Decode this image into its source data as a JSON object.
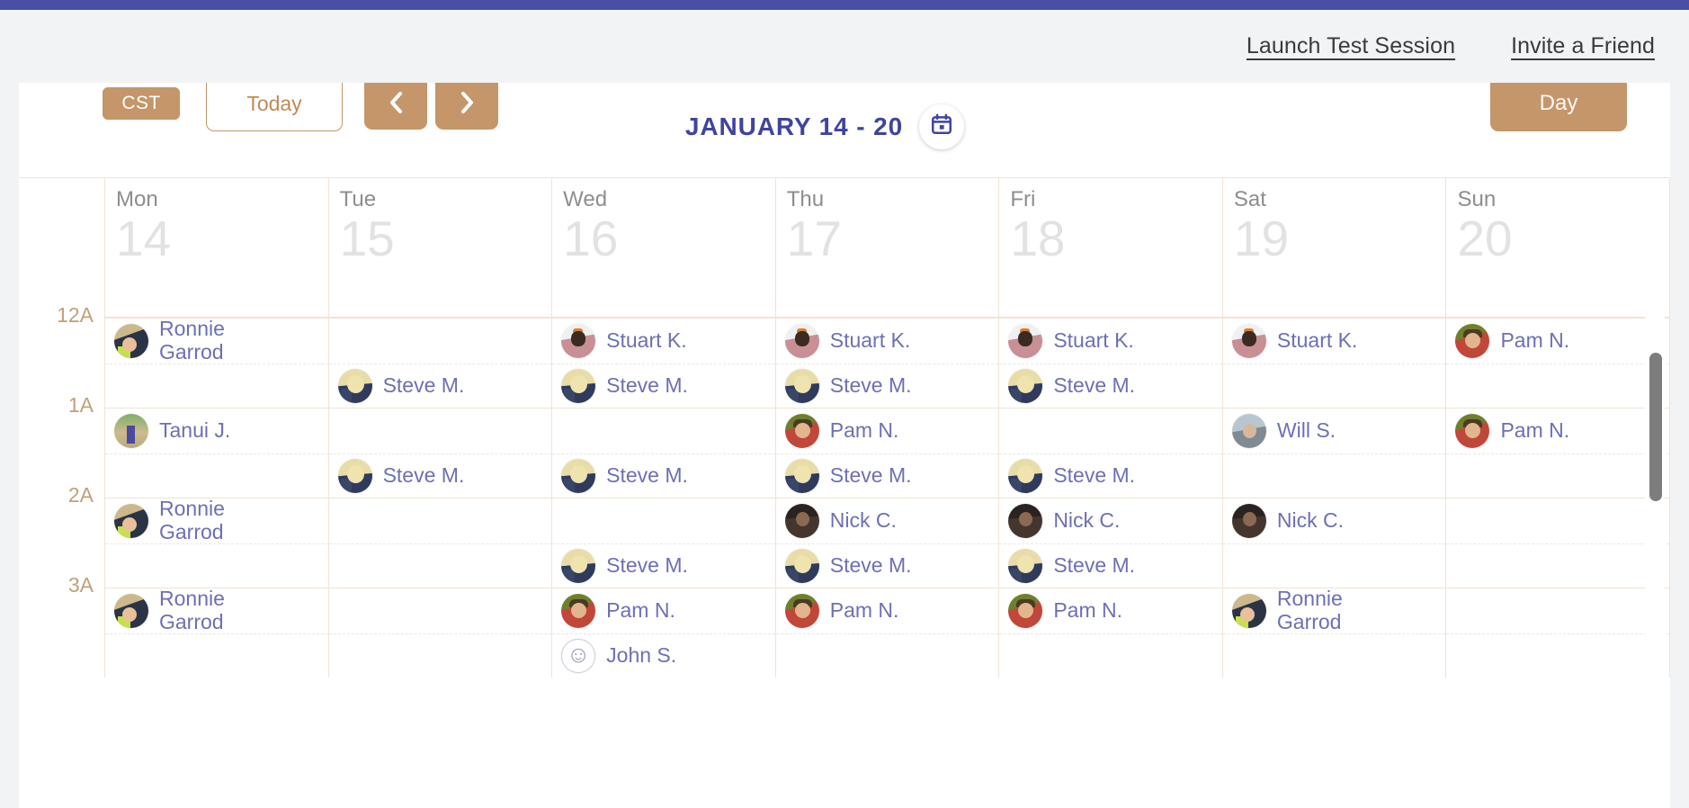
{
  "theme": {
    "purple_bar": "#4a4fa6",
    "accent_tan": "#c4966a",
    "title_blue": "#3f44a0",
    "event_text": "#6d6fb5",
    "grid_line": "#efe3d6",
    "hour_label": "#c0a079"
  },
  "header": {
    "links": [
      {
        "label": "Launch Test Session",
        "name": "launch-test-session-link"
      },
      {
        "label": "Invite a Friend",
        "name": "invite-a-friend-link"
      }
    ]
  },
  "toolbar": {
    "timezone_badge": "CST",
    "today_label": "Today",
    "prev_icon": "chevron-left-icon",
    "next_icon": "chevron-right-icon",
    "title": "JANUARY 14 - 20",
    "calendar_icon": "calendar-icon",
    "view_label": "Day"
  },
  "calendar": {
    "days": [
      {
        "name": "Mon",
        "num": "14"
      },
      {
        "name": "Tue",
        "num": "15"
      },
      {
        "name": "Wed",
        "num": "16"
      },
      {
        "name": "Thu",
        "num": "17"
      },
      {
        "name": "Fri",
        "num": "18"
      },
      {
        "name": "Sat",
        "num": "19"
      },
      {
        "name": "Sun",
        "num": "20"
      }
    ],
    "hours": [
      {
        "label": "12A",
        "cells": [
          {
            "top": {
              "name": "Ronnie Garrod",
              "avatar": "av-ronnie",
              "two_line": true
            },
            "bottom": null
          },
          {
            "top": null,
            "bottom": {
              "name": "Steve M.",
              "avatar": "av-steve"
            }
          },
          {
            "top": {
              "name": "Stuart K.",
              "avatar": "av-stuart"
            },
            "bottom": {
              "name": "Steve M.",
              "avatar": "av-steve"
            }
          },
          {
            "top": {
              "name": "Stuart K.",
              "avatar": "av-stuart"
            },
            "bottom": {
              "name": "Steve M.",
              "avatar": "av-steve"
            }
          },
          {
            "top": {
              "name": "Stuart K.",
              "avatar": "av-stuart"
            },
            "bottom": {
              "name": "Steve M.",
              "avatar": "av-steve"
            }
          },
          {
            "top": {
              "name": "Stuart K.",
              "avatar": "av-stuart"
            },
            "bottom": null
          },
          {
            "top": {
              "name": "Pam N.",
              "avatar": "av-pam"
            },
            "bottom": null
          }
        ]
      },
      {
        "label": "1A",
        "cells": [
          {
            "top": {
              "name": "Tanui J.",
              "avatar": "av-tanui"
            },
            "bottom": null
          },
          {
            "top": null,
            "bottom": {
              "name": "Steve M.",
              "avatar": "av-steve"
            }
          },
          {
            "top": null,
            "bottom": {
              "name": "Steve M.",
              "avatar": "av-steve"
            }
          },
          {
            "top": {
              "name": "Pam N.",
              "avatar": "av-pam"
            },
            "bottom": {
              "name": "Steve M.",
              "avatar": "av-steve"
            }
          },
          {
            "top": null,
            "bottom": {
              "name": "Steve M.",
              "avatar": "av-steve"
            }
          },
          {
            "top": {
              "name": "Will S.",
              "avatar": "av-will"
            },
            "bottom": null
          },
          {
            "top": {
              "name": "Pam N.",
              "avatar": "av-pam"
            },
            "bottom": null
          }
        ]
      },
      {
        "label": "2A",
        "cells": [
          {
            "top": {
              "name": "Ronnie Garrod",
              "avatar": "av-ronnie",
              "two_line": true
            },
            "bottom": null
          },
          {
            "top": null,
            "bottom": null
          },
          {
            "top": null,
            "bottom": {
              "name": "Steve M.",
              "avatar": "av-steve"
            }
          },
          {
            "top": {
              "name": "Nick C.",
              "avatar": "av-nick"
            },
            "bottom": {
              "name": "Steve M.",
              "avatar": "av-steve"
            }
          },
          {
            "top": {
              "name": "Nick C.",
              "avatar": "av-nick"
            },
            "bottom": {
              "name": "Steve M.",
              "avatar": "av-steve"
            }
          },
          {
            "top": {
              "name": "Nick C.",
              "avatar": "av-nick"
            },
            "bottom": null
          },
          {
            "top": null,
            "bottom": null
          }
        ]
      },
      {
        "label": "3A",
        "cells": [
          {
            "top": {
              "name": "Ronnie Garrod",
              "avatar": "av-ronnie",
              "two_line": true
            },
            "bottom": null
          },
          {
            "top": null,
            "bottom": null
          },
          {
            "top": {
              "name": "Pam N.",
              "avatar": "av-pam"
            },
            "bottom": {
              "name": "John S.",
              "avatar": "av-john"
            }
          },
          {
            "top": {
              "name": "Pam N.",
              "avatar": "av-pam"
            },
            "bottom": null
          },
          {
            "top": {
              "name": "Pam N.",
              "avatar": "av-pam"
            },
            "bottom": null
          },
          {
            "top": {
              "name": "Ronnie Garrod",
              "avatar": "av-ronnie",
              "two_line": true
            },
            "bottom": null
          },
          {
            "top": null,
            "bottom": null
          }
        ]
      }
    ]
  }
}
